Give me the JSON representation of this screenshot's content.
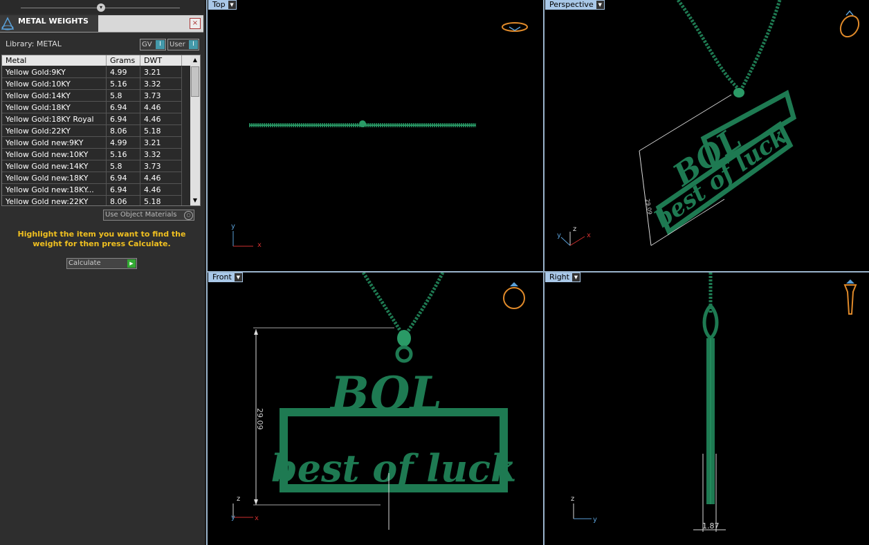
{
  "panel": {
    "title": "METAL WEIGHTS",
    "close_symbol": "×",
    "library_label": "Library: METAL",
    "toggle_gv": "GV",
    "toggle_user": "User",
    "columns": [
      "Metal",
      "Grams",
      "DWT"
    ],
    "rows": [
      {
        "metal": "Yellow Gold:9KY",
        "grams": "4.99",
        "dwt": "3.21"
      },
      {
        "metal": "Yellow Gold:10KY",
        "grams": "5.16",
        "dwt": "3.32"
      },
      {
        "metal": "Yellow Gold:14KY",
        "grams": "5.8",
        "dwt": "3.73"
      },
      {
        "metal": "Yellow Gold:18KY",
        "grams": "6.94",
        "dwt": "4.46"
      },
      {
        "metal": "Yellow Gold:18KY Royal",
        "grams": "6.94",
        "dwt": "4.46"
      },
      {
        "metal": "Yellow Gold:22KY",
        "grams": "8.06",
        "dwt": "5.18"
      },
      {
        "metal": "Yellow Gold new:9KY",
        "grams": "4.99",
        "dwt": "3.21"
      },
      {
        "metal": "Yellow Gold new:10KY",
        "grams": "5.16",
        "dwt": "3.32"
      },
      {
        "metal": "Yellow Gold new:14KY",
        "grams": "5.8",
        "dwt": "3.73"
      },
      {
        "metal": "Yellow Gold new:18KY",
        "grams": "6.94",
        "dwt": "4.46"
      },
      {
        "metal": "Yellow Gold new:18KY...",
        "grams": "6.94",
        "dwt": "4.46"
      },
      {
        "metal": "Yellow Gold new:22KY",
        "grams": "8.06",
        "dwt": "5.18"
      }
    ],
    "use_object_materials": "Use Object Materials",
    "hint": "Highlight the item you want to find the weight for then press Calculate.",
    "calculate_label": "Calculate"
  },
  "viewports": {
    "top": {
      "label": "Top",
      "axes": [
        "y",
        "x"
      ]
    },
    "perspective": {
      "label": "Perspective",
      "axes": [
        "z",
        "y",
        "x"
      ],
      "dimension": "29.09"
    },
    "front": {
      "label": "Front",
      "axes": [
        "z",
        "y",
        "x"
      ],
      "dimension": "29.09",
      "text_line1": "BOL",
      "text_line2": "best of luck"
    },
    "right": {
      "label": "Right",
      "axes": [
        "z",
        "y"
      ],
      "dimension": "1.87"
    }
  },
  "colors": {
    "model_green": "#1e7a52",
    "viewport_label_bg": "#a9c8e8",
    "hint_text": "#f0c020",
    "axis_x": "#d03030",
    "axis_y": "#5aa0d8",
    "axis_z": "#dddddd",
    "ring_icon": "#e08a2a"
  },
  "icons": [
    "ring-view-icon",
    "slider-knob-icon",
    "close-icon",
    "dropdown-arrow-icon",
    "calculate-arrow-icon"
  ]
}
